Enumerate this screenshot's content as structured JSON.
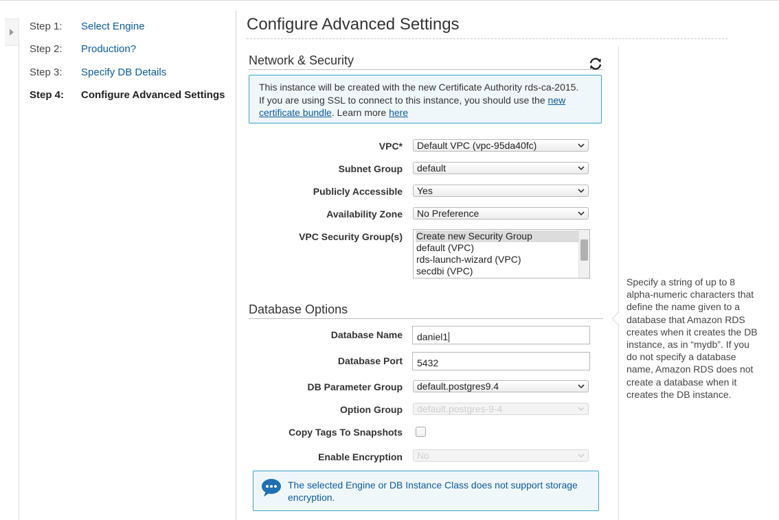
{
  "wizard": {
    "steps": [
      {
        "num": "Step 1:",
        "label": "Select Engine"
      },
      {
        "num": "Step 2:",
        "label": "Production?"
      },
      {
        "num": "Step 3:",
        "label": "Specify DB Details"
      },
      {
        "num": "Step 4:",
        "label": "Configure Advanced Settings"
      }
    ]
  },
  "page": {
    "title": "Configure Advanced Settings"
  },
  "network_security": {
    "title": "Network & Security",
    "refresh_icon": "refresh-icon",
    "info": {
      "line1": "This instance will be created with the new Certificate Authority rds-ca-2015.",
      "line2_text": "If you are using SSL to connect to this instance, you should use the ",
      "line2_link": "new",
      "line3_link": "certificate bundle",
      "line3_text": ". Learn more ",
      "line3_link2": "here"
    },
    "fields": {
      "vpc": {
        "label": "VPC*",
        "value": "Default VPC (vpc-95da40fc)"
      },
      "subnet_group": {
        "label": "Subnet Group",
        "value": "default"
      },
      "publicly_accessible": {
        "label": "Publicly Accessible",
        "value": "Yes"
      },
      "availability_zone": {
        "label": "Availability Zone",
        "value": "No Preference"
      },
      "vpc_security_groups": {
        "label": "VPC Security Group(s)",
        "options": [
          "Create new Security Group",
          "default (VPC)",
          "rds-launch-wizard (VPC)",
          "secdbi (VPC)"
        ],
        "selected_index": 0
      }
    }
  },
  "database_options": {
    "title": "Database Options",
    "fields": {
      "database_name": {
        "label": "Database Name",
        "value": "daniel1"
      },
      "database_port": {
        "label": "Database Port",
        "value": "5432"
      },
      "db_parameter_group": {
        "label": "DB Parameter Group",
        "value": "default.postgres9.4"
      },
      "option_group": {
        "label": "Option Group",
        "value": "default.postgres-9-4"
      },
      "copy_tags": {
        "label": "Copy Tags To Snapshots",
        "checked": false
      },
      "enable_encryption": {
        "label": "Enable Encryption",
        "value": "No"
      }
    },
    "notice": {
      "icon": "speech-bubble-icon",
      "line1": "The selected Engine or DB Instance Class does not support storage",
      "line2": "encryption."
    }
  },
  "help": {
    "lines": [
      "Specify a string of up to 8",
      "alpha-numeric characters that",
      "define the name given to a",
      "database that Amazon RDS",
      "creates when it creates the DB",
      "instance, as in “mydb”. If you",
      "do not specify a database",
      "name, Amazon RDS does not",
      "create a database when it",
      "creates the DB instance."
    ]
  },
  "colors": {
    "link": "#0b5b9d",
    "info_border": "#39a3c5",
    "info_bg": "#f0f7fa"
  }
}
